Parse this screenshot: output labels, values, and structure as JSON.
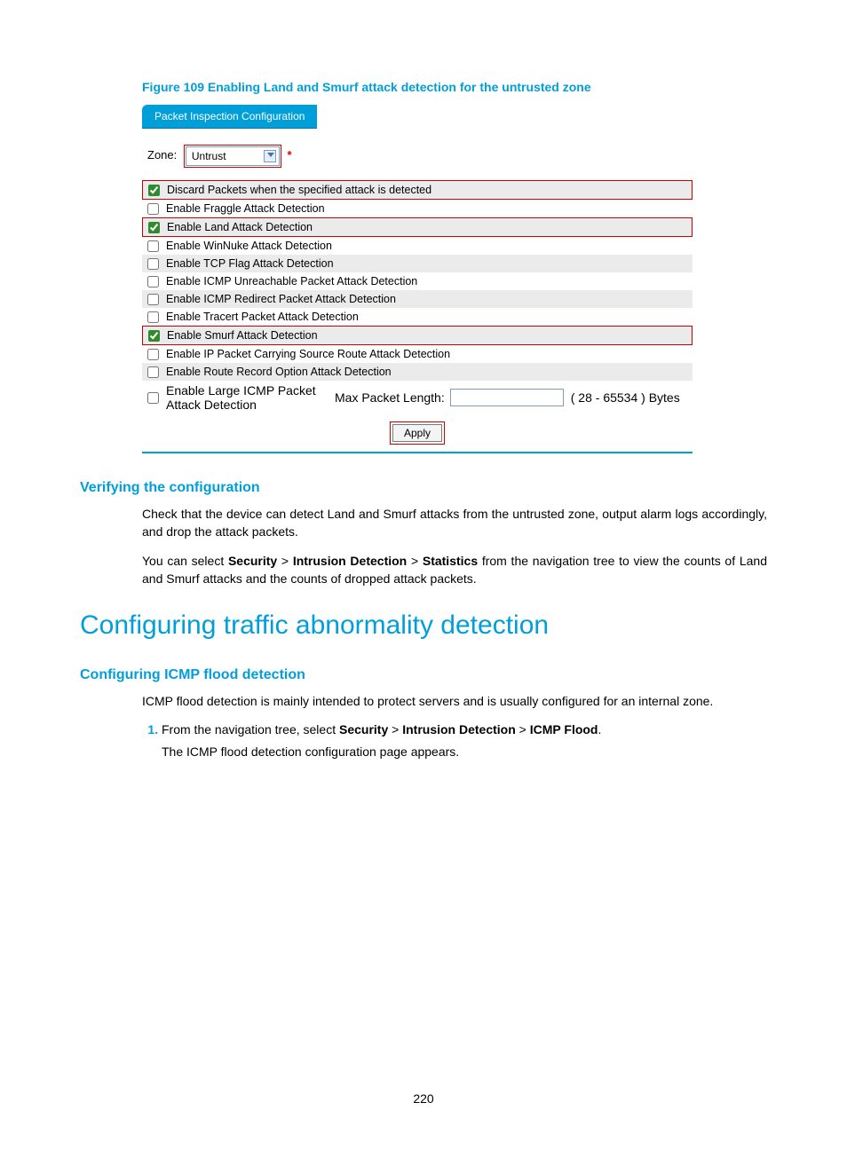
{
  "figure": {
    "caption": "Figure 109 Enabling Land and Smurf attack detection for the untrusted zone",
    "tab_title": "Packet Inspection Configuration",
    "zone_label": "Zone:",
    "zone_value": "Untrust",
    "required_mark": "*",
    "rows": [
      {
        "label": "Discard Packets when the specified attack is detected",
        "checked": true,
        "alt": true,
        "red": true
      },
      {
        "label": "Enable Fraggle Attack Detection",
        "checked": false,
        "alt": false,
        "red": false
      },
      {
        "label": "Enable Land Attack Detection",
        "checked": true,
        "alt": true,
        "red": true
      },
      {
        "label": "Enable WinNuke Attack Detection",
        "checked": false,
        "alt": false,
        "red": false
      },
      {
        "label": "Enable TCP Flag Attack Detection",
        "checked": false,
        "alt": true,
        "red": false
      },
      {
        "label": "Enable ICMP Unreachable Packet Attack Detection",
        "checked": false,
        "alt": false,
        "red": false
      },
      {
        "label": "Enable ICMP Redirect Packet Attack Detection",
        "checked": false,
        "alt": true,
        "red": false
      },
      {
        "label": "Enable Tracert Packet Attack Detection",
        "checked": false,
        "alt": false,
        "red": false
      },
      {
        "label": "Enable Smurf Attack Detection",
        "checked": true,
        "alt": true,
        "red": true
      },
      {
        "label": "Enable IP Packet Carrying Source Route Attack Detection",
        "checked": false,
        "alt": false,
        "red": false
      },
      {
        "label": "Enable Route Record Option Attack Detection",
        "checked": false,
        "alt": true,
        "red": false
      }
    ],
    "large_icmp": {
      "label": "Enable Large ICMP Packet Attack Detection",
      "max_label": "Max Packet Length:",
      "value": "",
      "range": "( 28 - 65534 ) Bytes"
    },
    "apply_label": "Apply"
  },
  "sections": {
    "verify_heading": "Verifying the configuration",
    "verify_p1": "Check that the device can detect Land and Smurf attacks from the untrusted zone, output alarm logs accordingly, and drop the attack packets.",
    "verify_p2_pre": "You can select ",
    "verify_nav1": "Security",
    "gt": " > ",
    "verify_nav2": "Intrusion Detection",
    "verify_nav3": "Statistics",
    "verify_p2_post": " from the navigation tree to view the counts of Land and Smurf attacks and the counts of dropped attack packets.",
    "h2": "Configuring traffic abnormality detection",
    "icmp_heading": "Configuring ICMP flood detection",
    "icmp_p1": "ICMP flood detection is mainly intended to protect servers and is usually configured for an internal zone.",
    "step1_pre": "From the navigation tree, select ",
    "step1_nav3": "ICMP Flood",
    "step1_post": ".",
    "step1_sub": "The ICMP flood detection configuration page appears."
  },
  "page_number": "220"
}
